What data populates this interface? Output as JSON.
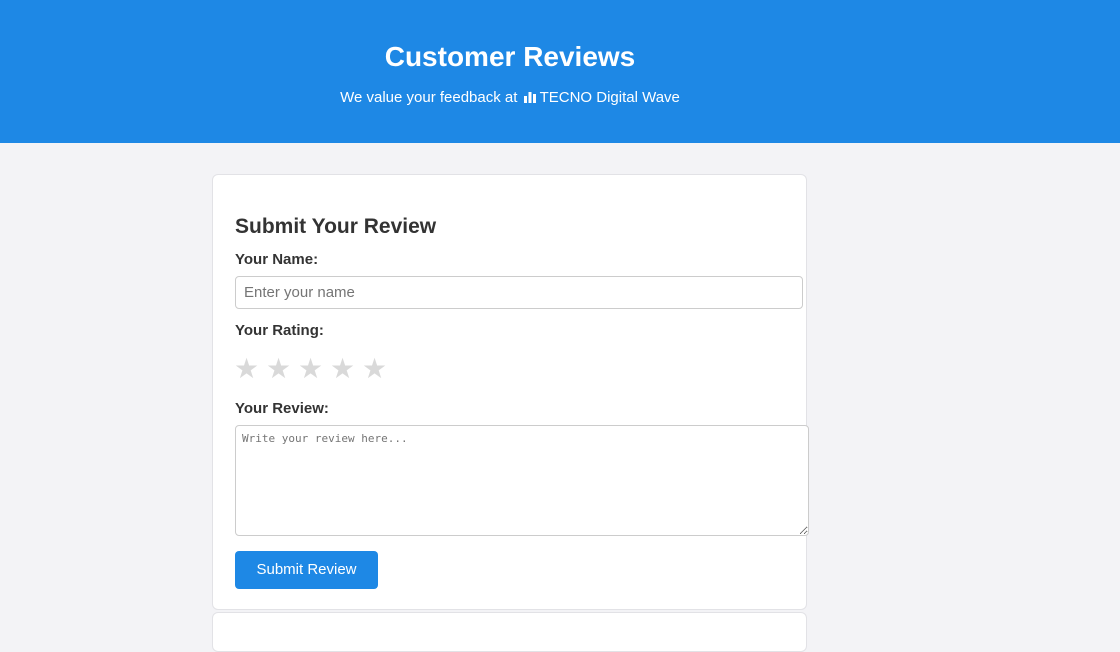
{
  "header": {
    "title": "Customer Reviews",
    "subtitle_prefix": "We value your feedback at",
    "brand": "TECNO Digital Wave",
    "brand_icon": "bar-chart-icon",
    "background_color": "#1e88e5"
  },
  "form": {
    "title": "Submit Your Review",
    "name_label": "Your Name:",
    "name_placeholder": "Enter your name",
    "name_value": "",
    "rating_label": "Your Rating:",
    "rating_value": 0,
    "rating_max": 5,
    "star_glyph": "★",
    "review_label": "Your Review:",
    "review_placeholder": "Write your review here...",
    "review_value": "",
    "submit_label": "Submit Review",
    "accent_color": "#1e88e5",
    "star_empty_color": "#d9d9d9"
  }
}
